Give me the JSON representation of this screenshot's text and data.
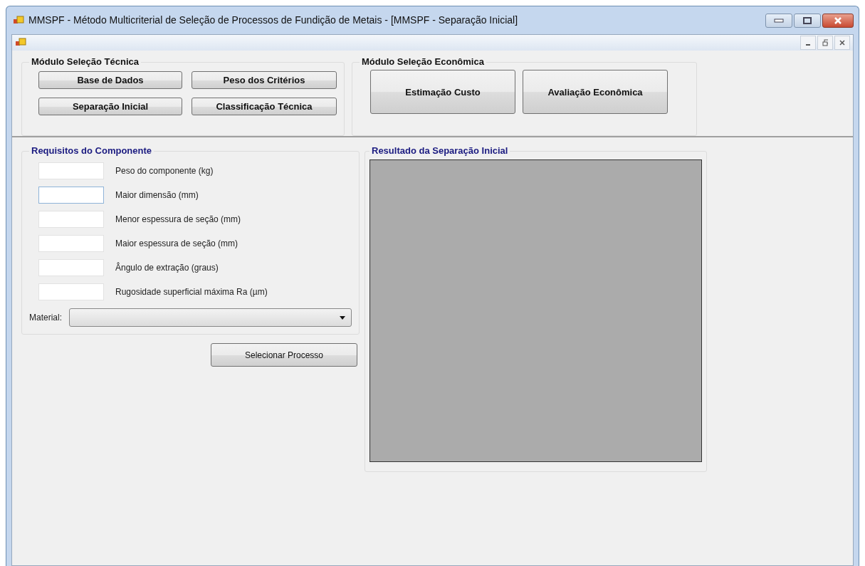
{
  "window": {
    "title": "MMSPF - Método Multicriterial de Seleção de Processos de Fundição de Metais - [MMSPF - Separação Inicial]"
  },
  "technical_module": {
    "title": "Módulo Seleção Técnica",
    "buttons": [
      "Base de Dados",
      "Peso dos Critérios",
      "Separação Inicial",
      "Classificação Técnica"
    ]
  },
  "economic_module": {
    "title": "Módulo Seleção Econômica",
    "buttons": [
      "Estimação Custo",
      "Avaliação Econômica"
    ]
  },
  "requirements": {
    "title": "Requisitos do Componente",
    "fields": [
      {
        "label": "Peso do componente (kg)",
        "focused": false
      },
      {
        "label": "Maior dimensão (mm)",
        "focused": true
      },
      {
        "label": "Menor espessura de seção (mm)",
        "focused": false
      },
      {
        "label": "Maior espessura de seção (mm)",
        "focused": false
      },
      {
        "label": "Ângulo de extração (graus)",
        "focused": false
      },
      {
        "label": "Rugosidade superficial máxima Ra (µm)",
        "focused": false
      }
    ],
    "material_label": "Material:"
  },
  "select_button": "Selecionar Processo",
  "result": {
    "title": "Resultado da Separação Inicial"
  }
}
